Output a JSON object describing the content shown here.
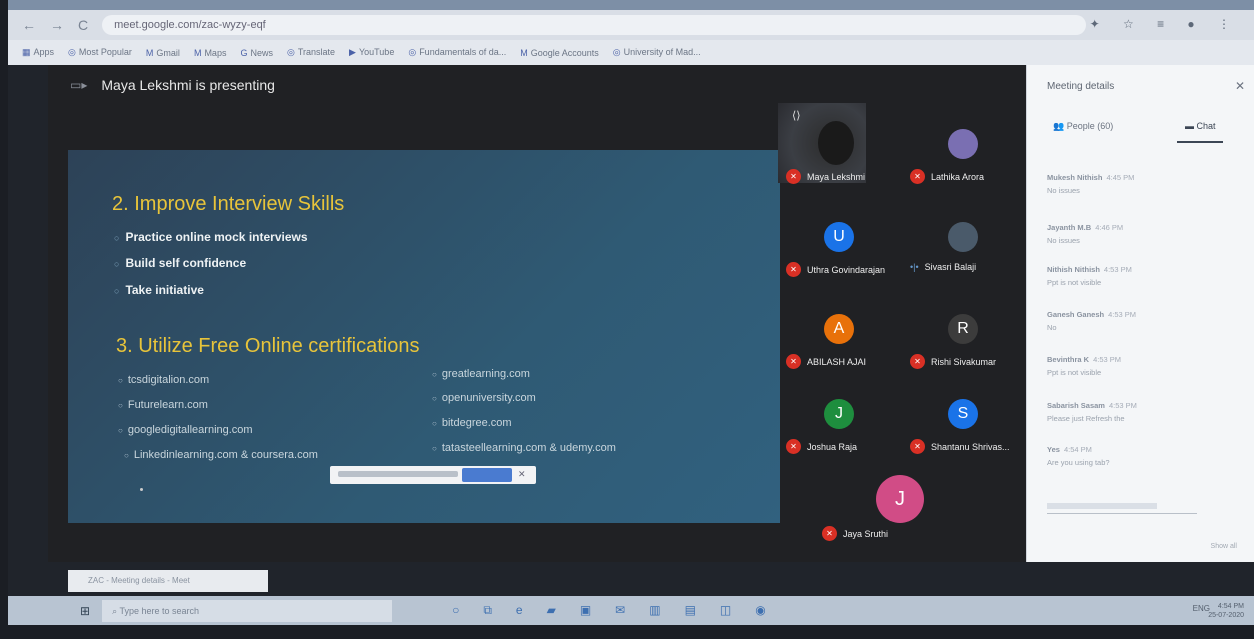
{
  "browser": {
    "url": "meet.google.com/zac-wyzy-eqf",
    "nav": [
      "←",
      "→",
      "C"
    ],
    "bookmarks": [
      "Apps",
      "Most Popular",
      "Gmail",
      "Maps",
      "News",
      "Translate",
      "YouTube",
      "Fundamentals of da...",
      "Google Accounts",
      "University of Mad..."
    ],
    "right_icons": "✦ ☆ ≡ ● ⋮"
  },
  "meet": {
    "presenting_text": "Maya Lekshmi is presenting",
    "slide": {
      "section1_title": "2. Improve Interview Skills",
      "section1_bullets": [
        "Practice online mock interviews",
        "Build self confidence",
        "Take initiative"
      ],
      "section2_title": "3. Utilize Free Online certifications",
      "links_left": [
        "tcsdigitalion.com",
        "Futurelearn.com",
        "googledigitallearning.com",
        "Linkedinlearning.com & coursera.com"
      ],
      "links_right": [
        "greatlearning.com",
        "openuniversity.com",
        "bitdegree.com",
        "tatasteellearning.com & udemy.com"
      ]
    },
    "participants": [
      {
        "name": "Maya Lekshmi",
        "initial": "",
        "color": ""
      },
      {
        "name": "Lathika Arora",
        "initial": "",
        "color": "#7a6fb2"
      },
      {
        "name": "Uthra Govindarajan",
        "initial": "U",
        "color": "#1a73e8"
      },
      {
        "name": "Sivasri Balaji",
        "initial": "",
        "color": "#4a5a6a"
      },
      {
        "name": "ABILASH AJAI",
        "initial": "A",
        "color": "#e8710a"
      },
      {
        "name": "Rishi Sivakumar",
        "initial": "R",
        "color": "#3c3c3c"
      },
      {
        "name": "Joshua Raja",
        "initial": "J",
        "color": "#1e8e3e"
      },
      {
        "name": "Shantanu Shrivas...",
        "initial": "S",
        "color": "#1a73e8"
      },
      {
        "name": "Jaya Sruthi",
        "initial": "J",
        "color": "#d14c86"
      }
    ]
  },
  "panel": {
    "title": "Meeting details",
    "tab_people": "People (60)",
    "tab_chat": "Chat",
    "messages": [
      {
        "name": "Mukesh Nithish",
        "time": "4:45 PM",
        "text": "No issues"
      },
      {
        "name": "Jayanth M.B",
        "time": "4:46 PM",
        "text": "No issues"
      },
      {
        "name": "Nithish Nithish",
        "time": "4:53 PM",
        "text": "Ppt is not visible"
      },
      {
        "name": "Ganesh Ganesh",
        "time": "4:53 PM",
        "text": "No"
      },
      {
        "name": "Bevinthra K",
        "time": "4:53 PM",
        "text": "Ppt is not visible"
      },
      {
        "name": "Sabarish Sasam",
        "time": "4:53 PM",
        "text": "Please just Refresh the"
      },
      {
        "name": "Yes",
        "time": "4:54 PM",
        "text": "Are you using tab?"
      }
    ],
    "show_all": "Show all"
  },
  "taskbar": {
    "pinned_label": "ZAC - Meeting details - Meet",
    "search_placeholder": "Type here to search",
    "tray_text": "ENG",
    "date_time": "4:54 PM\n25-07-2020"
  }
}
